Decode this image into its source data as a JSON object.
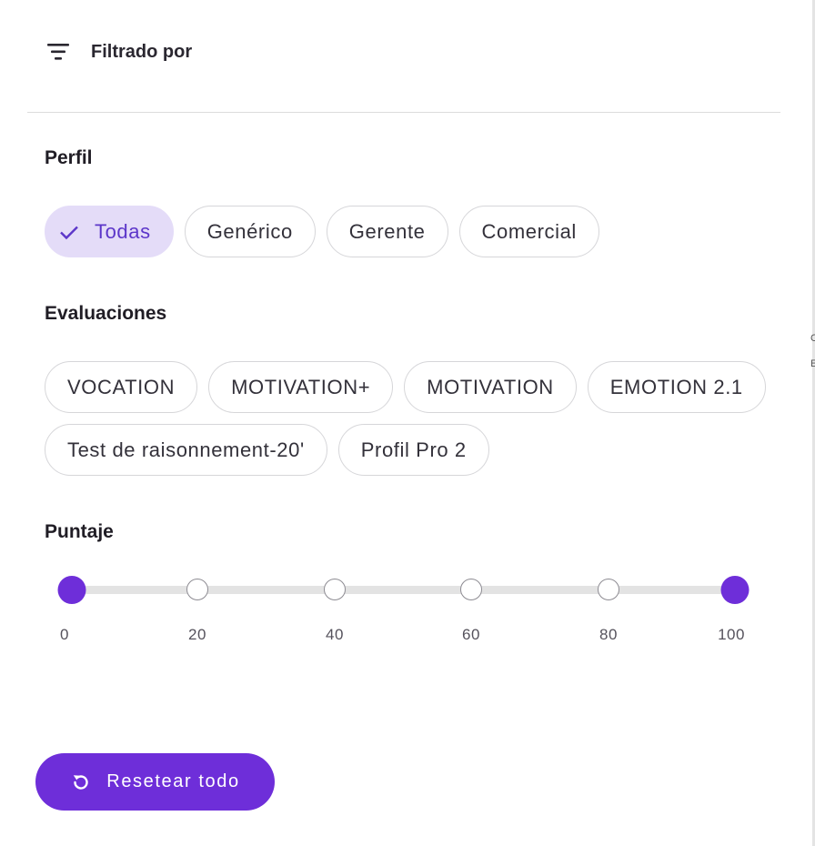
{
  "header": {
    "title": "Filtrado por",
    "icon": "filter-icon"
  },
  "profile": {
    "title": "Perfil",
    "chips": [
      {
        "label": "Todas",
        "selected": true
      },
      {
        "label": "Genérico",
        "selected": false
      },
      {
        "label": "Gerente",
        "selected": false
      },
      {
        "label": "Comercial",
        "selected": false
      }
    ]
  },
  "evaluations": {
    "title": "Evaluaciones",
    "chips": [
      {
        "label": "VOCATION"
      },
      {
        "label": "MOTIVATION+"
      },
      {
        "label": "MOTIVATION"
      },
      {
        "label": "EMOTION 2.1"
      },
      {
        "label": "Test de raisonnement-20'"
      },
      {
        "label": "Profil Pro 2"
      }
    ]
  },
  "score": {
    "title": "Puntaje",
    "ticks": [
      "0",
      "20",
      "40",
      "60",
      "80",
      "100"
    ],
    "range": [
      0,
      100
    ]
  },
  "reset": {
    "label": "Resetear todo",
    "icon": "refresh-icon"
  },
  "colors": {
    "accent": "#6e2ed9",
    "chip_selected_bg": "#e4dcf8",
    "chip_selected_text": "#5c36c9"
  }
}
